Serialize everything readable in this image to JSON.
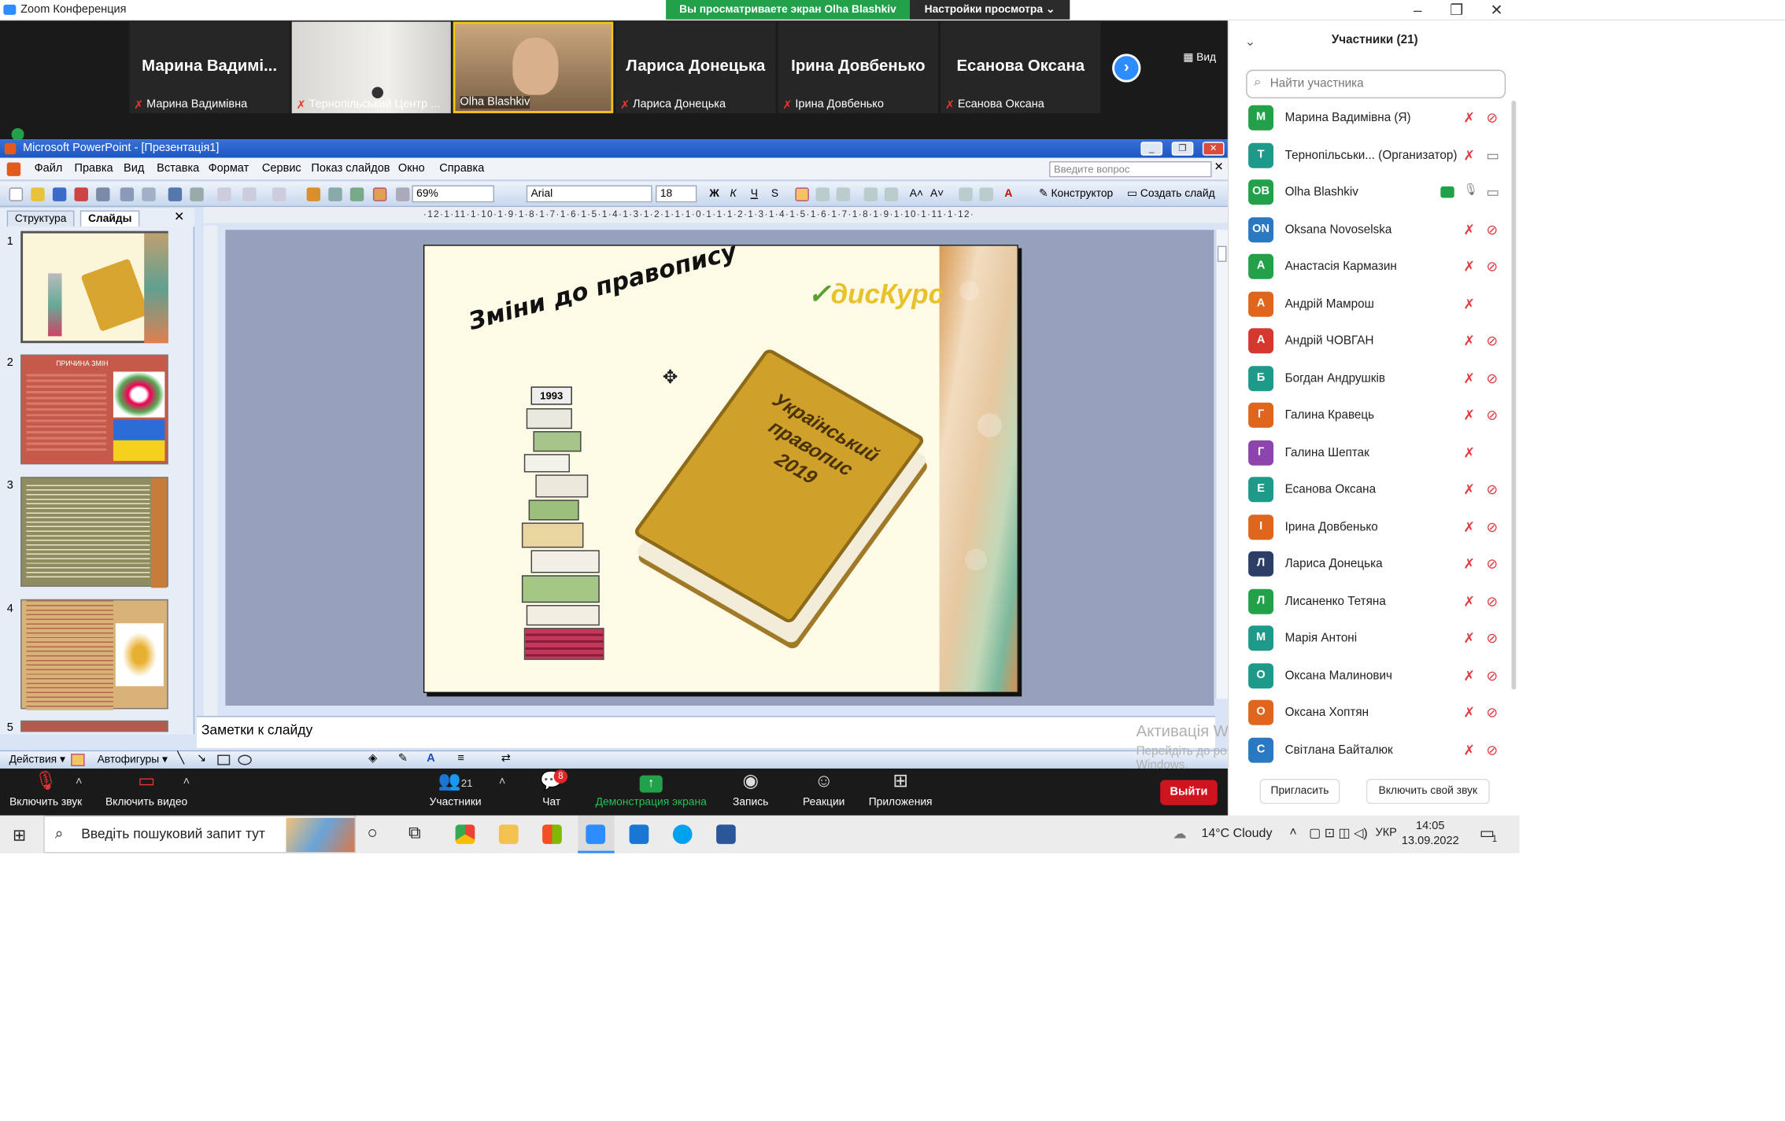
{
  "zoom": {
    "window_title": "Zoom Конференция",
    "viewing_banner": "Вы просматриваете экран Olha Blashkiv",
    "view_options": "Настройки просмотра",
    "view_label": "Вид"
  },
  "video_tiles": [
    {
      "big": "Марина Вадимі...",
      "caption": "Марина Вадимівна"
    },
    {
      "big": "",
      "caption": "Тернопільський Центр ..."
    },
    {
      "big": "",
      "caption": "Olha Blashkiv"
    },
    {
      "big": "Лариса Донецька",
      "caption": "Лариса Донецька"
    },
    {
      "big": "Ірина Довбенько",
      "caption": "Ірина Довбенько"
    },
    {
      "big": "Есанова Оксана",
      "caption": "Есанова Оксана"
    }
  ],
  "powerpoint": {
    "title": "Microsoft PowerPoint - [Презентація1]",
    "menu": [
      "Файл",
      "Правка",
      "Вид",
      "Вставка",
      "Формат",
      "Сервис",
      "Показ слайдов",
      "Окно",
      "Справка"
    ],
    "question_placeholder": "Введите вопрос",
    "zoom": "69%",
    "font": "Arial",
    "font_size": "18",
    "designer": "Конструктор",
    "new_slide": "Создать слайд",
    "tab_structure": "Структура",
    "tab_slides": "Слайды",
    "ruler": "·12·1·11·1·10·1·9·1·8·1·7·1·6·1·5·1·4·1·3·1·2·1·1·1·0·1·1·1·2·1·3·1·4·1·5·1·6·1·7·1·8·1·9·1·10·1·11·1·12·",
    "slide_numbers": [
      "1",
      "2",
      "3",
      "4",
      "5"
    ],
    "thumb2_title": "ПРИЧИНА ЗМІН",
    "slide": {
      "title": "Зміни до правопису",
      "book_title_l1": "Український",
      "book_title_l2": "правопис",
      "book_year": "2019",
      "logo": "дисКурс",
      "stack_year": "1993"
    },
    "notes_placeholder": "Заметки к слайду",
    "draw_actions": "Действия",
    "draw_autoshapes": "Автофигуры"
  },
  "participants": {
    "header": "Участники (21)",
    "search_placeholder": "Найти участника",
    "list": [
      {
        "initials": "М",
        "name": "Марина Вадимівна (Я)",
        "color": "#23a14a",
        "mic": "muted",
        "video": "off"
      },
      {
        "initials": "Т",
        "name": "Тернопільськи... (Организатор)",
        "color": "#1d9a8a",
        "mic": "muted",
        "video": "on"
      },
      {
        "initials": "OB",
        "name": "Olha Blashkiv",
        "color": "#23a14a",
        "mic": "on",
        "video": "on",
        "sharing": true
      },
      {
        "initials": "ON",
        "name": "Oksana Novoselska",
        "color": "#2a78c2",
        "mic": "muted",
        "video": "off"
      },
      {
        "initials": "А",
        "name": "Анастасія Кармазин",
        "color": "#23a14a",
        "mic": "muted",
        "video": "off"
      },
      {
        "initials": "А",
        "name": "Андрій Мамрош",
        "color": "#e0661b",
        "mic": "muted",
        "video": "none"
      },
      {
        "initials": "А",
        "name": "Андрій ЧОВГАН",
        "color": "#d6372e",
        "mic": "muted",
        "video": "off"
      },
      {
        "initials": "Б",
        "name": "Богдан Андрушків",
        "color": "#1d9a8a",
        "mic": "muted",
        "video": "off"
      },
      {
        "initials": "Г",
        "name": "Галина Кравець",
        "color": "#e0661b",
        "mic": "muted",
        "video": "off"
      },
      {
        "initials": "Г",
        "name": "Галина Шептак",
        "color": "#8e44ad",
        "mic": "muted",
        "video": "none"
      },
      {
        "initials": "Е",
        "name": "Есанова Оксана",
        "color": "#1d9a8a",
        "mic": "muted",
        "video": "off"
      },
      {
        "initials": "І",
        "name": "Ірина Довбенько",
        "color": "#e0661b",
        "mic": "muted",
        "video": "off"
      },
      {
        "initials": "Л",
        "name": "Лариса Донецька",
        "color": "#2c3e66",
        "mic": "muted",
        "video": "off"
      },
      {
        "initials": "Л",
        "name": "Лисаненко Тетяна",
        "color": "#23a14a",
        "mic": "muted",
        "video": "off"
      },
      {
        "initials": "М",
        "name": "Марія Антоні",
        "color": "#1d9a8a",
        "mic": "muted",
        "video": "off"
      },
      {
        "initials": "О",
        "name": "Оксана Малинович",
        "color": "#1d9a8a",
        "mic": "muted",
        "video": "off"
      },
      {
        "initials": "О",
        "name": "Оксана Хоптян",
        "color": "#e0661b",
        "mic": "muted",
        "video": "off"
      },
      {
        "initials": "С",
        "name": "Світлана Байталюк",
        "color": "#2a78c2",
        "mic": "muted",
        "video": "off"
      }
    ],
    "invite": "Пригласить",
    "unmute_me": "Включить свой звук"
  },
  "controls": {
    "audio": "Включить звук",
    "video": "Включить видео",
    "participants": "Участники",
    "participants_count": "21",
    "chat": "Чат",
    "chat_badge": "8",
    "share": "Демонстрация экрана",
    "record": "Запись",
    "reactions": "Реакции",
    "apps": "Приложения",
    "leave": "Выйти"
  },
  "activation": {
    "line1": "Активація Windows",
    "line2": "Перейдіть до розділу \"Настройки\", щоб активувати",
    "line3": "Windows."
  },
  "taskbar": {
    "search": "Введіть пошуковий запит тут",
    "weather": "14°C  Cloudy",
    "lang": "УКР",
    "time": "14:05",
    "date": "13.09.2022",
    "notif": "1"
  }
}
